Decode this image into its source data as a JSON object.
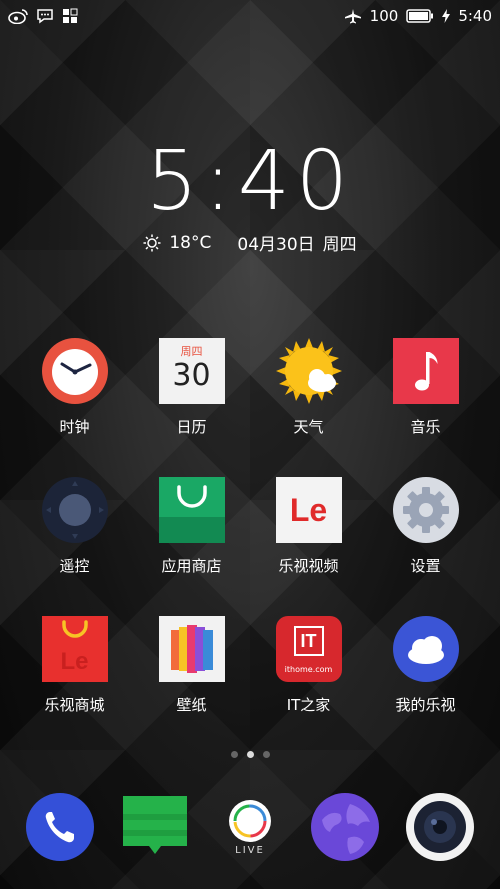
{
  "status_bar": {
    "left_icons": [
      "weibo-icon",
      "message-icon",
      "grid-app-icon"
    ],
    "airplane_icon": "airplane-icon",
    "battery_level": "100",
    "time": "5:40"
  },
  "clock": {
    "time": "5:40",
    "weather_icon": "sun-icon",
    "temperature": "18°C",
    "date": "04月30日",
    "weekday": "周四"
  },
  "apps": [
    {
      "label": "时钟",
      "icon": "clock-icon"
    },
    {
      "label": "日历",
      "icon": "calendar-icon",
      "calendar_weekday": "周四",
      "calendar_day": "30"
    },
    {
      "label": "天气",
      "icon": "weather-icon"
    },
    {
      "label": "音乐",
      "icon": "music-note-icon"
    },
    {
      "label": "遥控",
      "icon": "remote-icon"
    },
    {
      "label": "应用商店",
      "icon": "shopping-bag-icon"
    },
    {
      "label": "乐视视频",
      "icon": "le-video-icon",
      "logo_text": "Le"
    },
    {
      "label": "设置",
      "icon": "settings-gear-icon"
    },
    {
      "label": "乐视商城",
      "icon": "le-mall-icon",
      "logo_text": "Le"
    },
    {
      "label": "壁纸",
      "icon": "wallpaper-icon"
    },
    {
      "label": "IT之家",
      "icon": "ithome-icon",
      "logo_text": "IT",
      "logo_subtext": "ithome.com"
    },
    {
      "label": "我的乐视",
      "icon": "cloud-icon"
    }
  ],
  "page_indicator": {
    "count": 3,
    "active_index": 1
  },
  "dock": [
    {
      "icon": "phone-icon"
    },
    {
      "icon": "messages-icon"
    },
    {
      "icon": "live-icon",
      "label": "LIVE"
    },
    {
      "icon": "browser-globe-icon"
    },
    {
      "icon": "camera-icon"
    }
  ],
  "colors": {
    "clock_red": "#e8523f",
    "music_red": "#e8384a",
    "store_green": "#1aa865",
    "ithome_red": "#d7282d",
    "cloud_blue": "#3b55d6",
    "phone_blue": "#3450d8",
    "msg_green": "#25b24a",
    "globe_purple": "#6a48d8"
  }
}
